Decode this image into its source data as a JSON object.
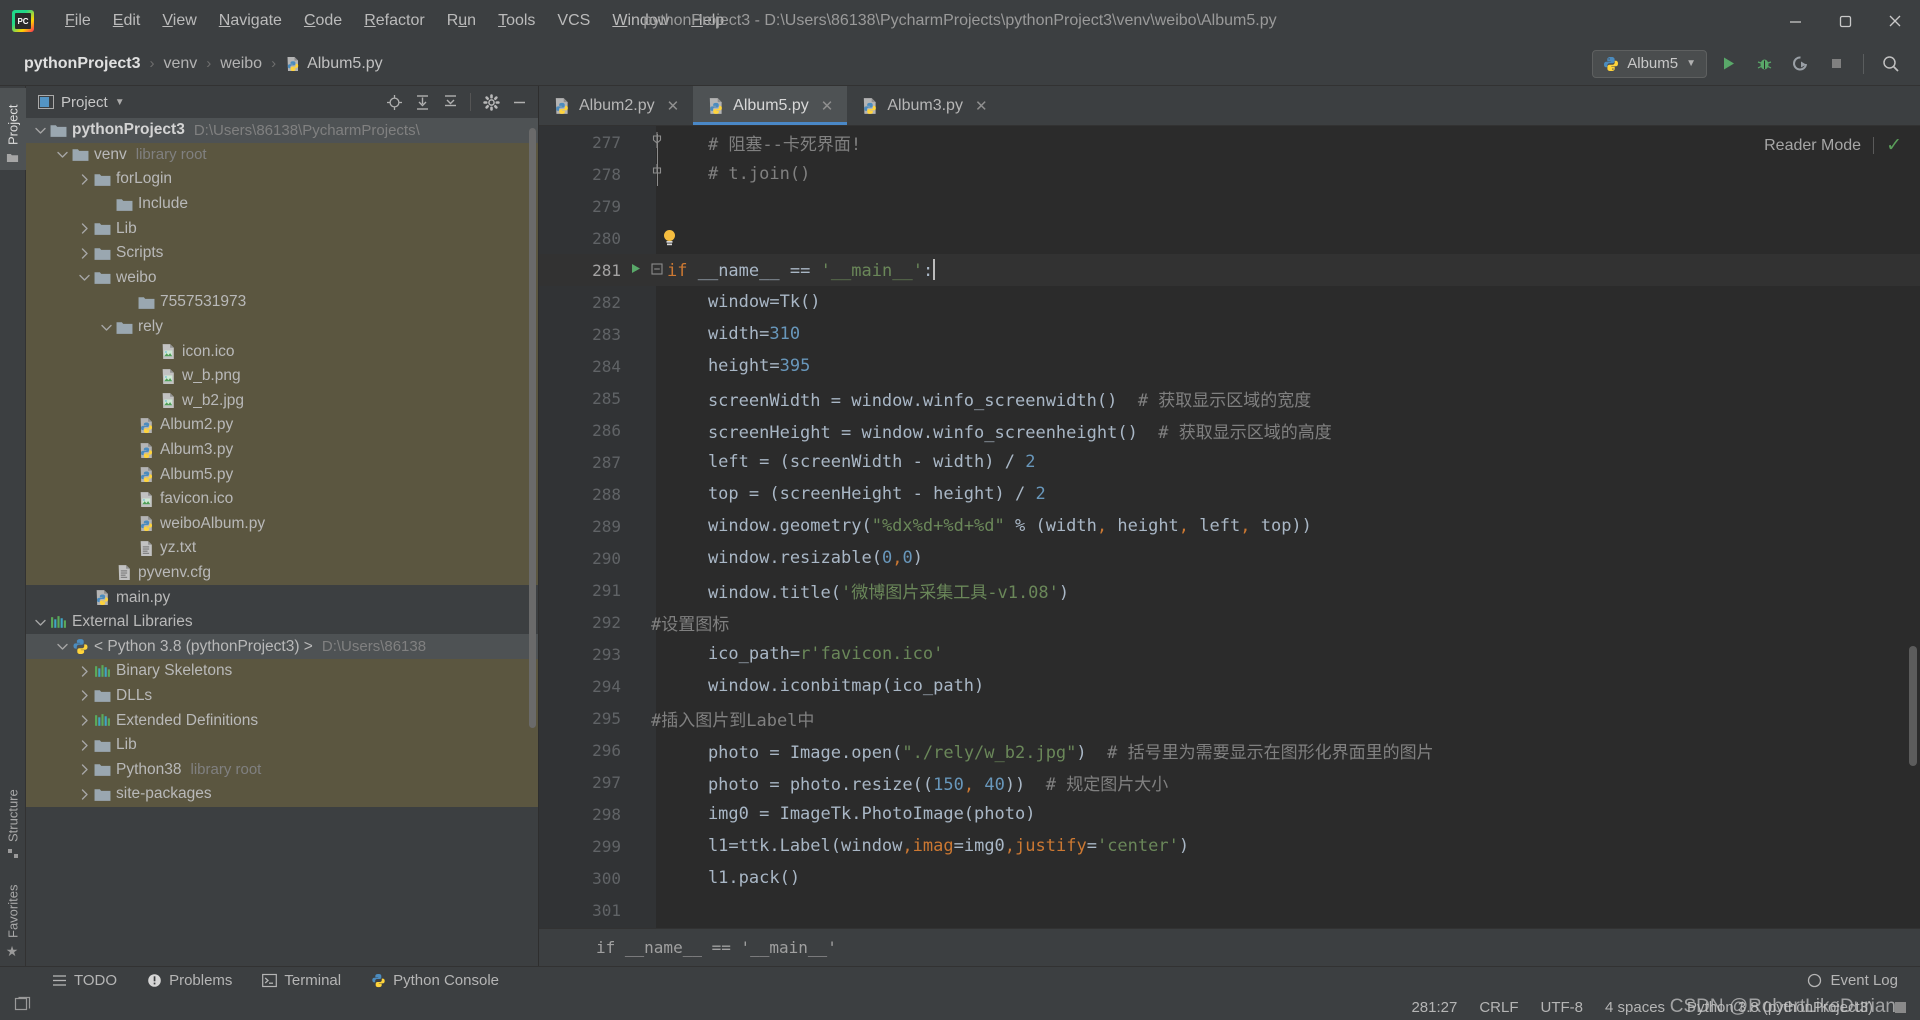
{
  "window": {
    "title": "pythonProject3 - D:\\Users\\86138\\PycharmProjects\\pythonProject3\\venv\\weibo\\Album5.py",
    "minimize": "—",
    "maximize": "❐",
    "close": "✕"
  },
  "menu": [
    {
      "label": "File",
      "mnemonic": "F"
    },
    {
      "label": "Edit",
      "mnemonic": "E"
    },
    {
      "label": "View",
      "mnemonic": "V"
    },
    {
      "label": "Navigate",
      "mnemonic": "N"
    },
    {
      "label": "Code",
      "mnemonic": "C"
    },
    {
      "label": "Refactor",
      "mnemonic": "R"
    },
    {
      "label": "Run",
      "mnemonic": "u"
    },
    {
      "label": "Tools",
      "mnemonic": "T"
    },
    {
      "label": "VCS",
      "mnemonic": ""
    },
    {
      "label": "Window",
      "mnemonic": "W"
    },
    {
      "label": "Help",
      "mnemonic": "H"
    }
  ],
  "breadcrumb": {
    "items": [
      "pythonProject3",
      "venv",
      "weibo"
    ],
    "separator": "›",
    "file": "Album5.py"
  },
  "toolbar": {
    "run_config": "Album5",
    "dropdown_caret": "▼",
    "run_label": "Run",
    "debug_label": "Debug",
    "coverage_label": "Run with Coverage",
    "stop_label": "Stop",
    "search_label": "Search Everywhere"
  },
  "left_strip": {
    "project": "Project",
    "structure": "Structure",
    "favorites": "Favorites"
  },
  "project_panel": {
    "title": "Project",
    "title_caret": "▾",
    "actions": [
      "locate-icon",
      "expand-all-icon",
      "collapse-all-icon",
      "settings-icon",
      "hide-icon"
    ],
    "tree": [
      {
        "indent": 0,
        "arrow": "down",
        "icon": "folder",
        "label": "pythonProject3",
        "hint": "D:\\Users\\86138\\PycharmProjects\\",
        "bold": true,
        "sel": "grey"
      },
      {
        "indent": 1,
        "arrow": "down",
        "icon": "folder",
        "label": "venv",
        "hint": "library root",
        "bold": false,
        "sel": "olive"
      },
      {
        "indent": 2,
        "arrow": "right",
        "icon": "folder",
        "label": "forLogin",
        "hint": "",
        "bold": false,
        "sel": "olive"
      },
      {
        "indent": 3,
        "arrow": "none",
        "icon": "folder",
        "label": "Include",
        "hint": "",
        "bold": false,
        "sel": "olive"
      },
      {
        "indent": 2,
        "arrow": "right",
        "icon": "folder",
        "label": "Lib",
        "hint": "",
        "bold": false,
        "sel": "olive"
      },
      {
        "indent": 2,
        "arrow": "right",
        "icon": "folder",
        "label": "Scripts",
        "hint": "",
        "bold": false,
        "sel": "olive"
      },
      {
        "indent": 2,
        "arrow": "down",
        "icon": "folder",
        "label": "weibo",
        "hint": "",
        "bold": false,
        "sel": "olive"
      },
      {
        "indent": 4,
        "arrow": "none",
        "icon": "folder",
        "label": "7557531973",
        "hint": "",
        "bold": false,
        "sel": "olive"
      },
      {
        "indent": 3,
        "arrow": "down",
        "icon": "folder",
        "label": "rely",
        "hint": "",
        "bold": false,
        "sel": "olive"
      },
      {
        "indent": 5,
        "arrow": "none",
        "icon": "image",
        "label": "icon.ico",
        "hint": "",
        "bold": false,
        "sel": "olive"
      },
      {
        "indent": 5,
        "arrow": "none",
        "icon": "image",
        "label": "w_b.png",
        "hint": "",
        "bold": false,
        "sel": "olive"
      },
      {
        "indent": 5,
        "arrow": "none",
        "icon": "image",
        "label": "w_b2.jpg",
        "hint": "",
        "bold": false,
        "sel": "olive"
      },
      {
        "indent": 4,
        "arrow": "none",
        "icon": "python",
        "label": "Album2.py",
        "hint": "",
        "bold": false,
        "sel": "olive"
      },
      {
        "indent": 4,
        "arrow": "none",
        "icon": "python",
        "label": "Album3.py",
        "hint": "",
        "bold": false,
        "sel": "olive"
      },
      {
        "indent": 4,
        "arrow": "none",
        "icon": "python",
        "label": "Album5.py",
        "hint": "",
        "bold": false,
        "sel": "olive"
      },
      {
        "indent": 4,
        "arrow": "none",
        "icon": "image",
        "label": "favicon.ico",
        "hint": "",
        "bold": false,
        "sel": "olive"
      },
      {
        "indent": 4,
        "arrow": "none",
        "icon": "python",
        "label": "weiboAlbum.py",
        "hint": "",
        "bold": false,
        "sel": "olive"
      },
      {
        "indent": 4,
        "arrow": "none",
        "icon": "text",
        "label": "yz.txt",
        "hint": "",
        "bold": false,
        "sel": "olive"
      },
      {
        "indent": 3,
        "arrow": "none",
        "icon": "text",
        "label": "pyvenv.cfg",
        "hint": "",
        "bold": false,
        "sel": "olive"
      },
      {
        "indent": 2,
        "arrow": "none",
        "icon": "python",
        "label": "main.py",
        "hint": "",
        "bold": false,
        "sel": "none"
      },
      {
        "indent": 0,
        "arrow": "down",
        "icon": "library",
        "label": "External Libraries",
        "hint": "",
        "bold": false,
        "sel": "none"
      },
      {
        "indent": 1,
        "arrow": "down",
        "icon": "pythonsdk",
        "label": "< Python 3.8 (pythonProject3) >",
        "hint": "D:\\Users\\86138",
        "bold": false,
        "sel": "grey"
      },
      {
        "indent": 2,
        "arrow": "right",
        "icon": "library",
        "label": "Binary Skeletons",
        "hint": "",
        "bold": false,
        "sel": "olive"
      },
      {
        "indent": 2,
        "arrow": "right",
        "icon": "folder",
        "label": "DLLs",
        "hint": "",
        "bold": false,
        "sel": "olive"
      },
      {
        "indent": 2,
        "arrow": "right",
        "icon": "library",
        "label": "Extended Definitions",
        "hint": "",
        "bold": false,
        "sel": "olive"
      },
      {
        "indent": 2,
        "arrow": "right",
        "icon": "folder",
        "label": "Lib",
        "hint": "",
        "bold": false,
        "sel": "olive"
      },
      {
        "indent": 2,
        "arrow": "right",
        "icon": "folder",
        "label": "Python38",
        "hint": "library root",
        "bold": false,
        "sel": "olive"
      },
      {
        "indent": 2,
        "arrow": "right",
        "icon": "folder",
        "label": "site-packages",
        "hint": "",
        "bold": false,
        "sel": "olive"
      }
    ]
  },
  "editor": {
    "tabs": [
      {
        "label": "Album2.py",
        "active": false,
        "close": "✕"
      },
      {
        "label": "Album5.py",
        "active": true,
        "close": "✕"
      },
      {
        "label": "Album3.py",
        "active": false,
        "close": "✕"
      }
    ],
    "reader_mode": "Reader Mode",
    "reader_check": "✓",
    "breadcrumb_status": "if __name__ == '__main__'",
    "lines": [
      {
        "num": "277",
        "fold": "fold-mid",
        "run": false,
        "bulb": false,
        "cur": false,
        "tokens": [
          {
            "t": "    ",
            "c": ""
          },
          {
            "t": "# 阻塞--卡死界面!",
            "c": "cmt"
          }
        ]
      },
      {
        "num": "278",
        "fold": "fold-end",
        "run": false,
        "bulb": false,
        "cur": false,
        "tokens": [
          {
            "t": "    ",
            "c": ""
          },
          {
            "t": "# t.join()",
            "c": "cmt"
          }
        ]
      },
      {
        "num": "279",
        "fold": "",
        "run": false,
        "bulb": false,
        "cur": false,
        "tokens": []
      },
      {
        "num": "280",
        "fold": "",
        "run": false,
        "bulb": true,
        "cur": false,
        "tokens": []
      },
      {
        "num": "281",
        "fold": "fold-open",
        "run": true,
        "bulb": false,
        "cur": true,
        "tokens": [
          {
            "t": "if",
            "c": "kw"
          },
          {
            "t": " __name__ ",
            "c": ""
          },
          {
            "t": "==",
            "c": ""
          },
          {
            "t": " ",
            "c": ""
          },
          {
            "t": "'__main__'",
            "c": "str"
          },
          {
            "t": ":",
            "c": ""
          },
          {
            "t": "|CARET|",
            "c": "caret"
          }
        ]
      },
      {
        "num": "282",
        "fold": "",
        "run": false,
        "bulb": false,
        "cur": false,
        "tokens": [
          {
            "t": "    window=Tk()",
            "c": ""
          }
        ]
      },
      {
        "num": "283",
        "fold": "",
        "run": false,
        "bulb": false,
        "cur": false,
        "tokens": [
          {
            "t": "    width=",
            "c": ""
          },
          {
            "t": "310",
            "c": "num"
          }
        ]
      },
      {
        "num": "284",
        "fold": "",
        "run": false,
        "bulb": false,
        "cur": false,
        "tokens": [
          {
            "t": "    height=",
            "c": ""
          },
          {
            "t": "395",
            "c": "num"
          }
        ]
      },
      {
        "num": "285",
        "fold": "",
        "run": false,
        "bulb": false,
        "cur": false,
        "tokens": [
          {
            "t": "    screenWidth = window.winfo_screenwidth()  ",
            "c": ""
          },
          {
            "t": "# 获取显示区域的宽度",
            "c": "cmt"
          }
        ]
      },
      {
        "num": "286",
        "fold": "",
        "run": false,
        "bulb": false,
        "cur": false,
        "tokens": [
          {
            "t": "    screenHeight = window.winfo_screenheight()  ",
            "c": ""
          },
          {
            "t": "# 获取显示区域的高度",
            "c": "cmt"
          }
        ]
      },
      {
        "num": "287",
        "fold": "",
        "run": false,
        "bulb": false,
        "cur": false,
        "tokens": [
          {
            "t": "    left = (screenWidth - width) / ",
            "c": ""
          },
          {
            "t": "2",
            "c": "num"
          }
        ]
      },
      {
        "num": "288",
        "fold": "",
        "run": false,
        "bulb": false,
        "cur": false,
        "tokens": [
          {
            "t": "    top = (screenHeight - height) / ",
            "c": ""
          },
          {
            "t": "2",
            "c": "num"
          }
        ]
      },
      {
        "num": "289",
        "fold": "",
        "run": false,
        "bulb": false,
        "cur": false,
        "tokens": [
          {
            "t": "    window.geometry(",
            "c": ""
          },
          {
            "t": "\"%dx%d+%d+%d\"",
            "c": "str"
          },
          {
            "t": " % (width",
            "c": ""
          },
          {
            "t": ",",
            "c": "kw"
          },
          {
            "t": " height",
            "c": ""
          },
          {
            "t": ",",
            "c": "kw"
          },
          {
            "t": " left",
            "c": ""
          },
          {
            "t": ",",
            "c": "kw"
          },
          {
            "t": " top))",
            "c": ""
          }
        ]
      },
      {
        "num": "290",
        "fold": "",
        "run": false,
        "bulb": false,
        "cur": false,
        "tokens": [
          {
            "t": "    window.resizable(",
            "c": ""
          },
          {
            "t": "0",
            "c": "num"
          },
          {
            "t": ",",
            "c": "kw"
          },
          {
            "t": "0",
            "c": "num"
          },
          {
            "t": ")",
            "c": ""
          }
        ]
      },
      {
        "num": "291",
        "fold": "",
        "run": false,
        "bulb": false,
        "cur": false,
        "tokens": [
          {
            "t": "    window.title(",
            "c": ""
          },
          {
            "t": "'微博图片采集工具-v1.08'",
            "c": "str"
          },
          {
            "t": ")",
            "c": ""
          }
        ]
      },
      {
        "num": "292",
        "fold": "",
        "run": false,
        "bulb": false,
        "cur": false,
        "nopad": true,
        "tokens": [
          {
            "t": "#设置图标",
            "c": "cmt"
          }
        ]
      },
      {
        "num": "293",
        "fold": "",
        "run": false,
        "bulb": false,
        "cur": false,
        "tokens": [
          {
            "t": "    ico_path=",
            "c": ""
          },
          {
            "t": "r'favicon.ico'",
            "c": "str"
          }
        ]
      },
      {
        "num": "294",
        "fold": "",
        "run": false,
        "bulb": false,
        "cur": false,
        "tokens": [
          {
            "t": "    window.iconbitmap(ico_path)",
            "c": ""
          }
        ]
      },
      {
        "num": "295",
        "fold": "",
        "run": false,
        "bulb": false,
        "cur": false,
        "nopad": true,
        "tokens": [
          {
            "t": "#插入图片到Label中",
            "c": "cmt"
          }
        ]
      },
      {
        "num": "296",
        "fold": "",
        "run": false,
        "bulb": false,
        "cur": false,
        "tokens": [
          {
            "t": "    photo = Image.open(",
            "c": ""
          },
          {
            "t": "\"./rely/w_b2.jpg\"",
            "c": "str"
          },
          {
            "t": ")  ",
            "c": ""
          },
          {
            "t": "# 括号里为需要显示在图形化界面里的图片",
            "c": "cmt"
          }
        ]
      },
      {
        "num": "297",
        "fold": "",
        "run": false,
        "bulb": false,
        "cur": false,
        "tokens": [
          {
            "t": "    photo = photo.resize((",
            "c": ""
          },
          {
            "t": "150",
            "c": "num"
          },
          {
            "t": ",",
            "c": "kw"
          },
          {
            "t": " ",
            "c": ""
          },
          {
            "t": "40",
            "c": "num"
          },
          {
            "t": "))  ",
            "c": ""
          },
          {
            "t": "# 规定图片大小",
            "c": "cmt"
          }
        ]
      },
      {
        "num": "298",
        "fold": "",
        "run": false,
        "bulb": false,
        "cur": false,
        "tokens": [
          {
            "t": "    img0 = ImageTk.PhotoImage(photo)",
            "c": ""
          }
        ]
      },
      {
        "num": "299",
        "fold": "",
        "run": false,
        "bulb": false,
        "cur": false,
        "tokens": [
          {
            "t": "    l1=ttk.Label(window",
            "c": ""
          },
          {
            "t": ",",
            "c": "kw"
          },
          {
            "t": "imag",
            "c": "param"
          },
          {
            "t": "=img0",
            "c": ""
          },
          {
            "t": ",",
            "c": "kw"
          },
          {
            "t": "justify",
            "c": "param"
          },
          {
            "t": "=",
            "c": ""
          },
          {
            "t": "'center'",
            "c": "str"
          },
          {
            "t": ")",
            "c": ""
          }
        ]
      },
      {
        "num": "300",
        "fold": "",
        "run": false,
        "bulb": false,
        "cur": false,
        "tokens": [
          {
            "t": "    l1.pack()",
            "c": ""
          }
        ]
      },
      {
        "num": "301",
        "fold": "",
        "run": false,
        "bulb": false,
        "cur": false,
        "tokens": []
      }
    ]
  },
  "bottom_bar": {
    "windows": [
      {
        "label": "TODO",
        "icon": "todo-icon"
      },
      {
        "label": "Problems",
        "icon": "problems-icon"
      },
      {
        "label": "Terminal",
        "icon": "terminal-icon"
      },
      {
        "label": "Python Console",
        "icon": "python-icon"
      }
    ],
    "event_log": "Event Log"
  },
  "status_bar": {
    "caret_position": "281:27",
    "line_separator": "CRLF",
    "encoding": "UTF-8",
    "indent": "4 spaces",
    "interpreter": "Python 3.8 (pythonProject3)",
    "watermark": "CSDN @RobertLikeDurian"
  },
  "colors": {
    "accent_blue": "#4a88c7",
    "editor_bg": "#2b2b2b",
    "panel_bg": "#3c3f41",
    "gutter_bg": "#313335",
    "selection_olive": "#5b5640",
    "selection_grey": "#4e5254",
    "string_green": "#6a8759",
    "keyword_orange": "#cc7832",
    "number_blue": "#6897bb",
    "comment_grey": "#808080",
    "text_default": "#a9b7c6"
  }
}
